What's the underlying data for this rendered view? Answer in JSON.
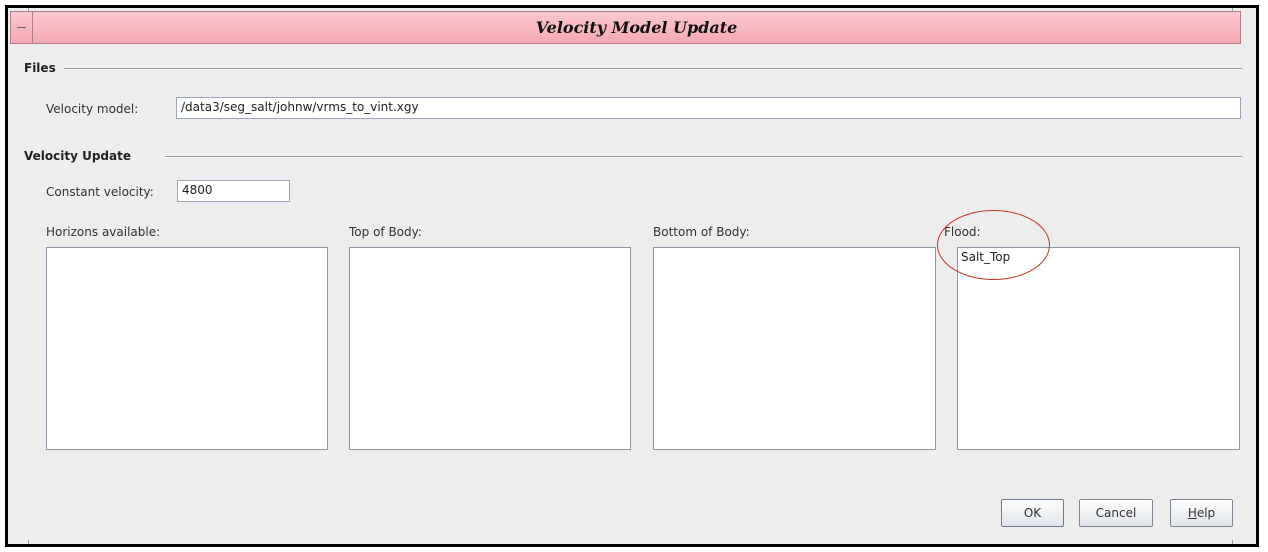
{
  "window": {
    "title": "Velocity Model Update"
  },
  "files": {
    "section_title": "Files",
    "velocity_model_label": "Velocity model:",
    "velocity_model_value": "/data3/seg_salt/johnw/vrms_to_vint.xgy"
  },
  "velocity_update": {
    "section_title": "Velocity Update",
    "constant_velocity_label": "Constant velocity:",
    "constant_velocity_value": "4800",
    "lists": [
      {
        "label": "Horizons available:",
        "items": []
      },
      {
        "label": "Top of Body:",
        "items": []
      },
      {
        "label": "Bottom of Body:",
        "items": []
      },
      {
        "label": "Flood:",
        "items": [
          "Salt_Top"
        ]
      }
    ]
  },
  "buttons": {
    "ok": "OK",
    "cancel": "Cancel",
    "help_mnemonic": "H",
    "help_rest": "elp"
  },
  "colors": {
    "titlebar": "#f4a9b3",
    "annotation_circle": "#c0392b"
  }
}
